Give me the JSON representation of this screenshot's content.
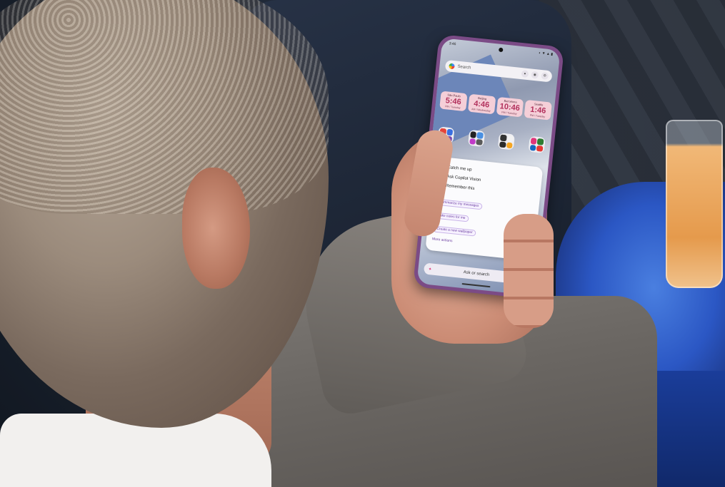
{
  "photo": {
    "phone": {
      "status_bar": {
        "time": "3:46",
        "icons": "◐ ▼ ▲ ▮"
      },
      "search_bar": {
        "placeholder": "Search"
      },
      "world_clocks": [
        {
          "city": "São Paulo",
          "time": "5:46",
          "day": "PM / Tuesday"
        },
        {
          "city": "Beijing",
          "time": "4:46",
          "day": "AM / Wednesday"
        },
        {
          "city": "Barcelona",
          "time": "10:46",
          "day": "PM / Tuesday"
        },
        {
          "city": "Seattle",
          "time": "1:46",
          "day": "PM / Tuesday"
        }
      ],
      "copilot_menu": {
        "items": [
          "Catch me up",
          "Ask Copilot Vision",
          "Remember this"
        ],
        "suggestions": [
          "Summarize my messages",
          "Take notes for me",
          "Create a new wallpaper"
        ],
        "more_label": "More actions"
      },
      "ask_bar": {
        "label": "Ask or search"
      }
    },
    "colors": {
      "phone_frame": "#7b4b86",
      "clock_widget": "#f5cfd8",
      "clock_text": "#b2305c",
      "accent": "#6a3ca0",
      "table": "#2b57c4",
      "drink": "#e59a4c"
    }
  }
}
